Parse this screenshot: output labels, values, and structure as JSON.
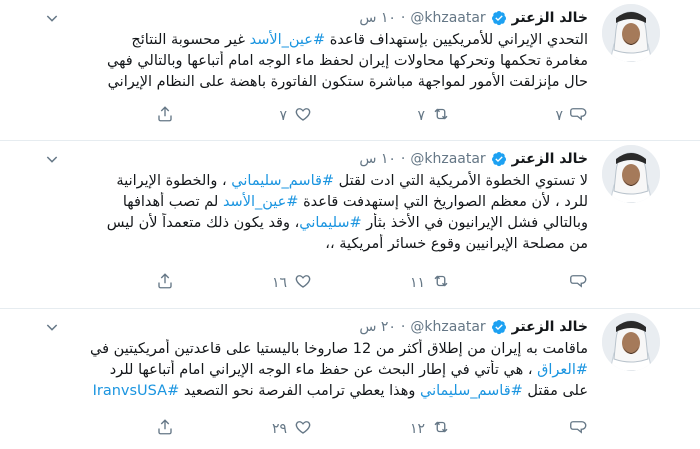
{
  "tweets": [
    {
      "name": "خالد الزعتر",
      "handle": "@khzaatar",
      "time": "١٠ س",
      "lines": [
        [
          {
            "t": "التحدي الإيراني للأمريكيين بإستهداف قاعدة "
          },
          {
            "t": "#عين_الأسد",
            "link": true
          },
          {
            "t": " غير محسوبة النتائج"
          }
        ],
        [
          {
            "t": "مغامرة تحكمها وتحركها محاولات إيران لحفظ ماء الوجه امام أتباعها وبالتالي فهي"
          }
        ],
        [
          {
            "t": "حال مإنزلقت الأمور لمواجهة مباشرة ستكون الفاتورة باهضة على النظام الإيراني"
          }
        ]
      ],
      "replies": "٧",
      "retweets": "٧",
      "likes": "٧"
    },
    {
      "name": "خالد الزعتر",
      "handle": "@khzaatar",
      "time": "١٠ س",
      "lines": [
        [
          {
            "t": "لا تستوي الخطوة الأمريكية التي ادت لقتل "
          },
          {
            "t": "#قاسم_سليماني",
            "link": true
          },
          {
            "t": " ، والخطوة الإيرانية"
          }
        ],
        [
          {
            "t": "للرد ، لأن معظم الصواريخ التي إستهدفت قاعدة "
          },
          {
            "t": "#عين_الأسد",
            "link": true
          },
          {
            "t": " لم تصب أهدافها"
          }
        ],
        [
          {
            "t": "وبالتالي فشل الإيرانيون في الأخذ بثأر "
          },
          {
            "t": "#سليماني",
            "link": true
          },
          {
            "t": "، وقد يكون ذلك متعمداً لأن ليس"
          }
        ],
        [
          {
            "t": "من مصلحة الإيرانيين وقوع خسائر أمريكية ،،"
          }
        ]
      ],
      "replies": "",
      "retweets": "١١",
      "likes": "١٦"
    },
    {
      "name": "خالد الزعتر",
      "handle": "@khzaatar",
      "time": "٢٠ س",
      "lines": [
        [
          {
            "t": "ماقامت به إيران من إطلاق أكثر من 12 صاروخا باليستيا على قاعدتين أمريكيتين في"
          }
        ],
        [
          {
            "t": "#العراق",
            "link": true
          },
          {
            "t": " ، هي تأتي في إطار البحث عن حفظ ماء الوجه الإيراني امام أتباعها للرد"
          }
        ],
        [
          {
            "t": "على مقتل "
          },
          {
            "t": "#قاسم_سليماني",
            "link": true
          },
          {
            "t": " وهذا يعطي ترامب الفرصة نحو التصعيد "
          },
          {
            "t": "#IranvsUSA",
            "link": true
          }
        ]
      ],
      "replies": "",
      "retweets": "١٢",
      "likes": "٢٩"
    }
  ],
  "icons": {
    "verified": "verified-badge-icon",
    "caret": "chevron-down-icon",
    "reply": "reply-icon",
    "retweet": "retweet-icon",
    "like": "heart-icon",
    "share": "share-icon"
  },
  "colors": {
    "link": "#1b95e0",
    "verified": "#1da1f2",
    "secondary": "#657786",
    "divider": "#e6ecf0"
  }
}
